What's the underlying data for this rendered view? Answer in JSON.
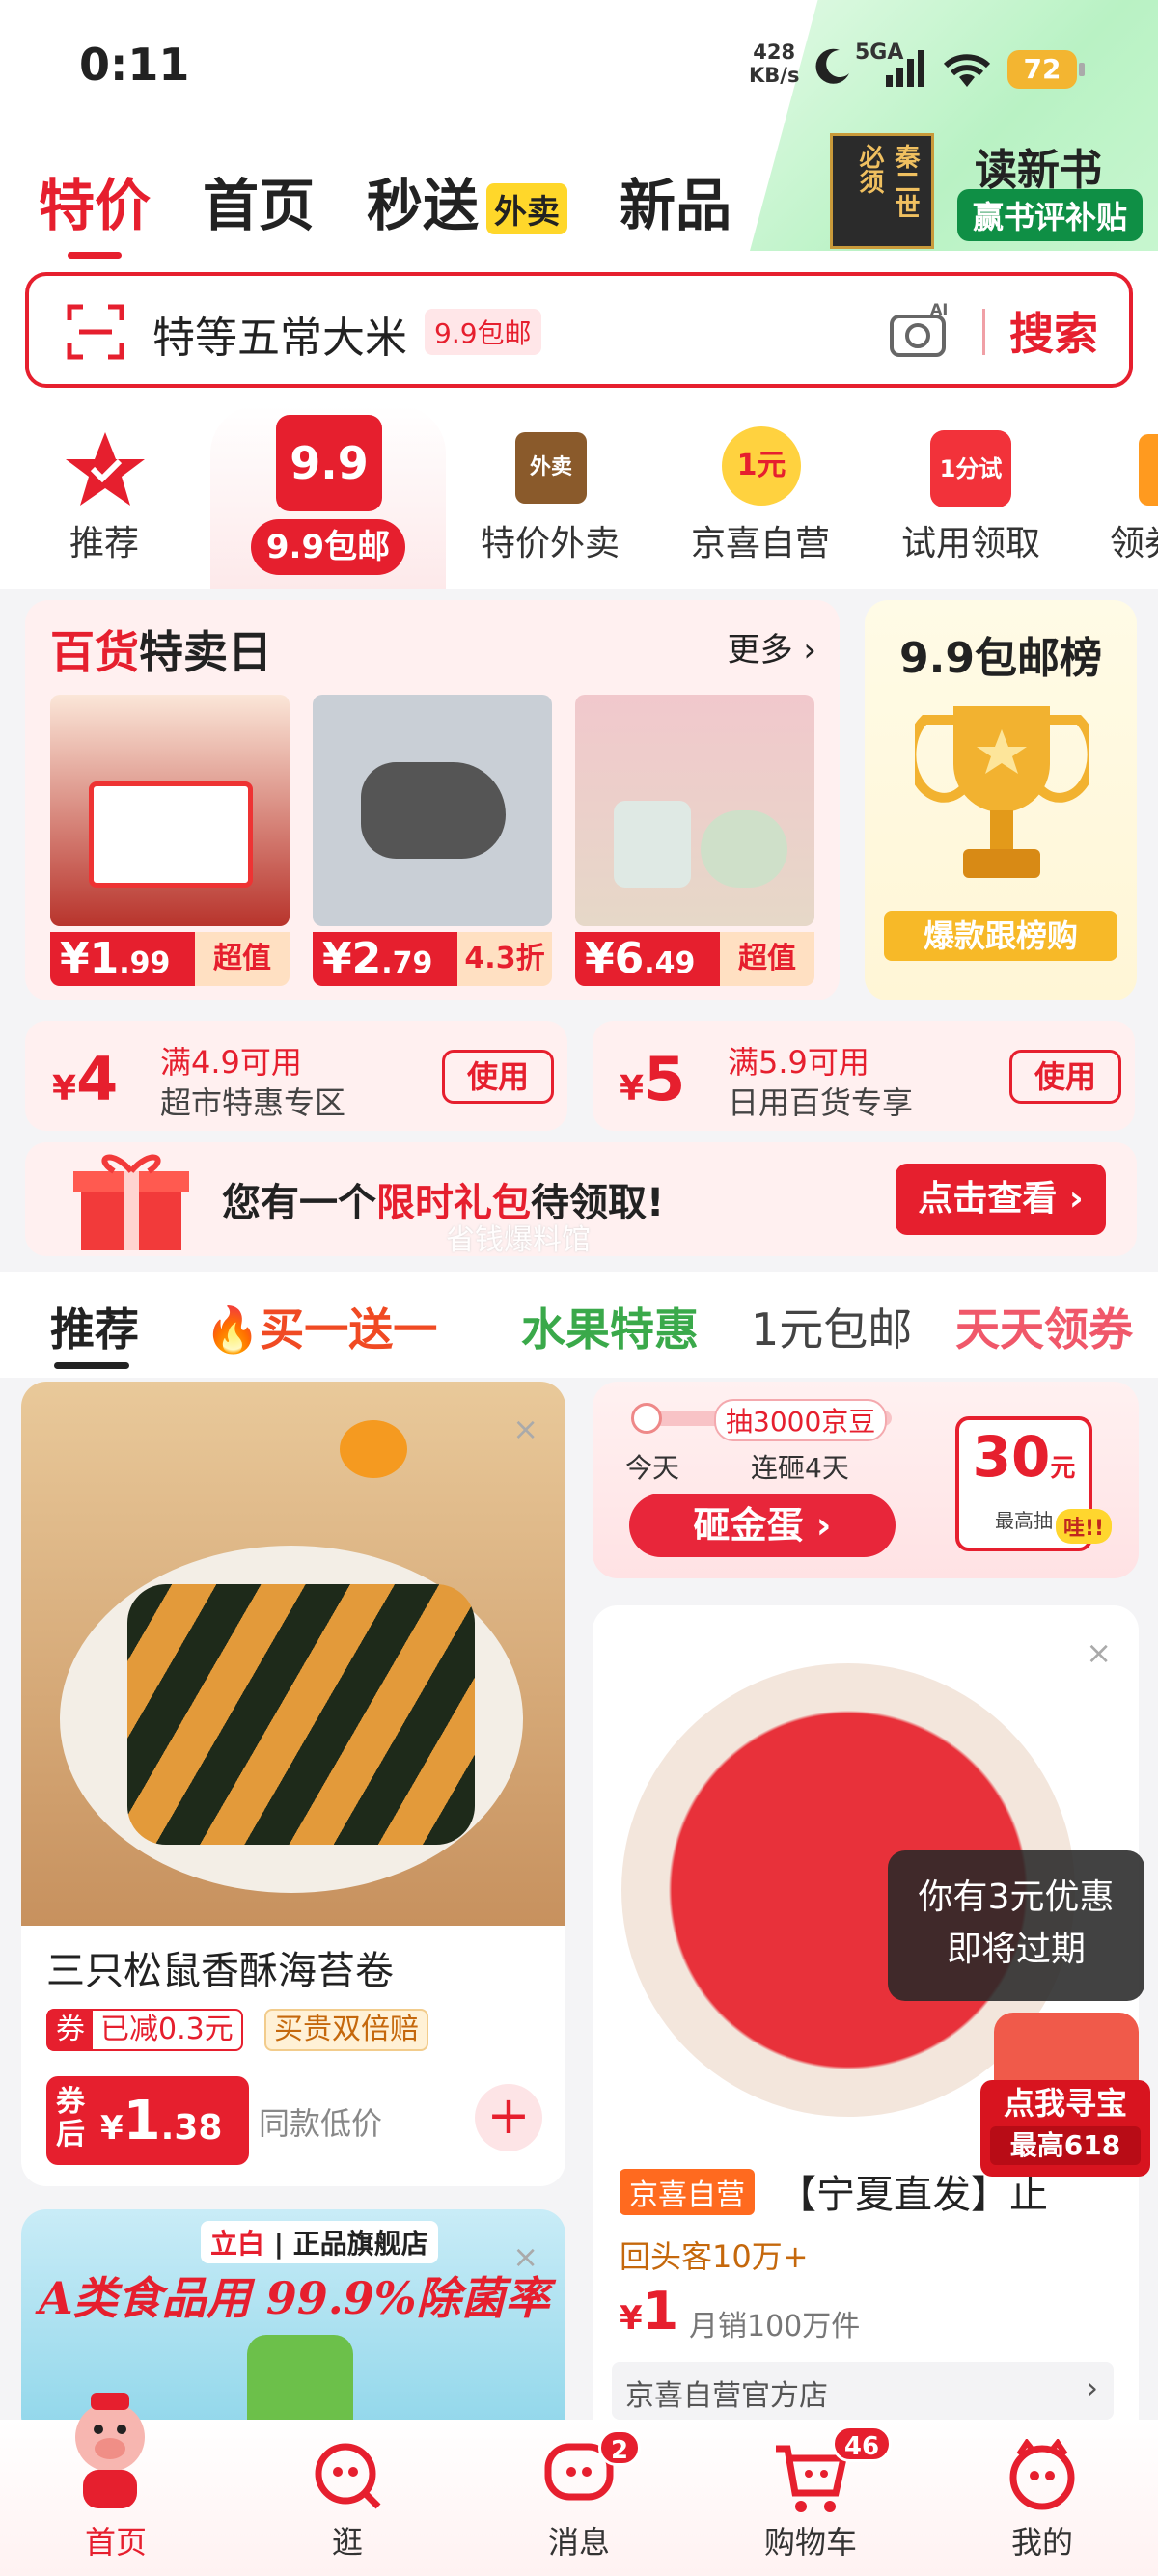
{
  "status": {
    "time": "0:11",
    "speed_value": "428",
    "speed_unit": "KB/s",
    "network": "5GA",
    "battery": "72"
  },
  "nav": {
    "items": [
      "特价",
      "首页",
      "秒送",
      "新品"
    ],
    "waimai_tag": "外卖",
    "promo_book": "秦二世 必须",
    "promo_title": "读新书",
    "promo_sub": "赢书评补贴"
  },
  "search": {
    "query": "特等五常大米",
    "tag": "9.9包邮",
    "button": "搜索",
    "ai": "AI"
  },
  "cats": {
    "items": [
      "推荐",
      "特价外卖",
      "京喜自营",
      "试用领取",
      "领券"
    ],
    "badge99": "9.9",
    "label99": "9.9包邮",
    "icon_waimai": "外卖",
    "icon_1yuan": "1元",
    "icon_trial": "1分试"
  },
  "sale": {
    "title_red": "百货",
    "title_black": "特卖日",
    "more": "更多 ›",
    "products": [
      {
        "price": "1",
        "cents": ".99",
        "tag": "超值"
      },
      {
        "price": "2",
        "cents": ".79",
        "tag": "4.3折"
      },
      {
        "price": "6",
        "cents": ".49",
        "tag": "超值"
      }
    ]
  },
  "rank": {
    "title": "9.9包邮榜",
    "button": "爆款跟榜购"
  },
  "coupons": [
    {
      "amount": "4",
      "cond": "满4.9可用",
      "scope": "超市特惠专区",
      "use": "使用"
    },
    {
      "amount": "5",
      "cond": "满5.9可用",
      "scope": "日用百货专享",
      "use": "使用"
    }
  ],
  "gift": {
    "pre": "您有一个",
    "mid": "限时礼包",
    "post": "待领取!",
    "button": "点击查看 ›",
    "watermark": "省钱爆料馆"
  },
  "tabs": [
    "推荐",
    "买一送一",
    "水果特惠",
    "1元包邮",
    "天天领券"
  ],
  "feed": {
    "item1": {
      "title": "三只松鼠香酥海苔卷",
      "tag1": "券",
      "tag1_text": "已减0.3元",
      "tag2": "买贵双倍赔",
      "price_label": "券后",
      "price": "1",
      "cents": ".38",
      "note": "同款低价"
    },
    "egg": {
      "banner": "抽3000京豆",
      "today": "今天",
      "streak": "连砸4天",
      "button": "砸金蛋 ›",
      "amount": "30",
      "unit": "元",
      "max": "最高抽",
      "wa": "哇!!"
    },
    "item2": {
      "tag": "京喜自营",
      "title": "【宁夏直发】止",
      "repeat": "回头客10万+",
      "price": "1",
      "sales": "月销100万件",
      "shop": "京喜自营官方店"
    },
    "tooltip": {
      "line1": "你有3元优惠",
      "line2": "即将过期"
    },
    "treasure": {
      "line1": "点我寻宝",
      "line2": "最高618"
    },
    "item3": {
      "brand": "立白",
      "store": "正品旗舰店",
      "headline": "A类食品用 99.9%除菌率"
    }
  },
  "bottom": {
    "items": [
      "首页",
      "逛",
      "消息",
      "购物车",
      "我的"
    ],
    "msg_badge": "2",
    "cart_badge": "46"
  }
}
